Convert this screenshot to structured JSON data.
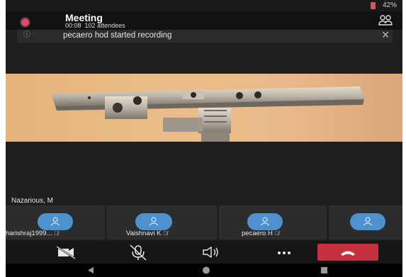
{
  "status_bar": {
    "battery": "42%"
  },
  "meeting": {
    "title": "Meeting",
    "elapsed": "00:08",
    "attendees": "102 attendees"
  },
  "notification": {
    "text": "pecaero hod started recording"
  },
  "active_speaker": {
    "name": "Nazarious, M"
  },
  "participants": [
    {
      "name": "harishraj1999..."
    },
    {
      "name": "Vaishnavi K"
    },
    {
      "name": "pecaero H"
    },
    {
      "name": ""
    }
  ],
  "toolbar": {
    "camera_icon": "video-off-icon",
    "mic_icon": "mic-off-icon",
    "speaker_icon": "speaker-icon",
    "more_icon": "more-icon",
    "end_icon": "hang-up-icon"
  },
  "colors": {
    "accent_avatar": "#4d91cf",
    "end_call": "#c8303e",
    "record": "#e0485f",
    "battery": "#e05555"
  }
}
